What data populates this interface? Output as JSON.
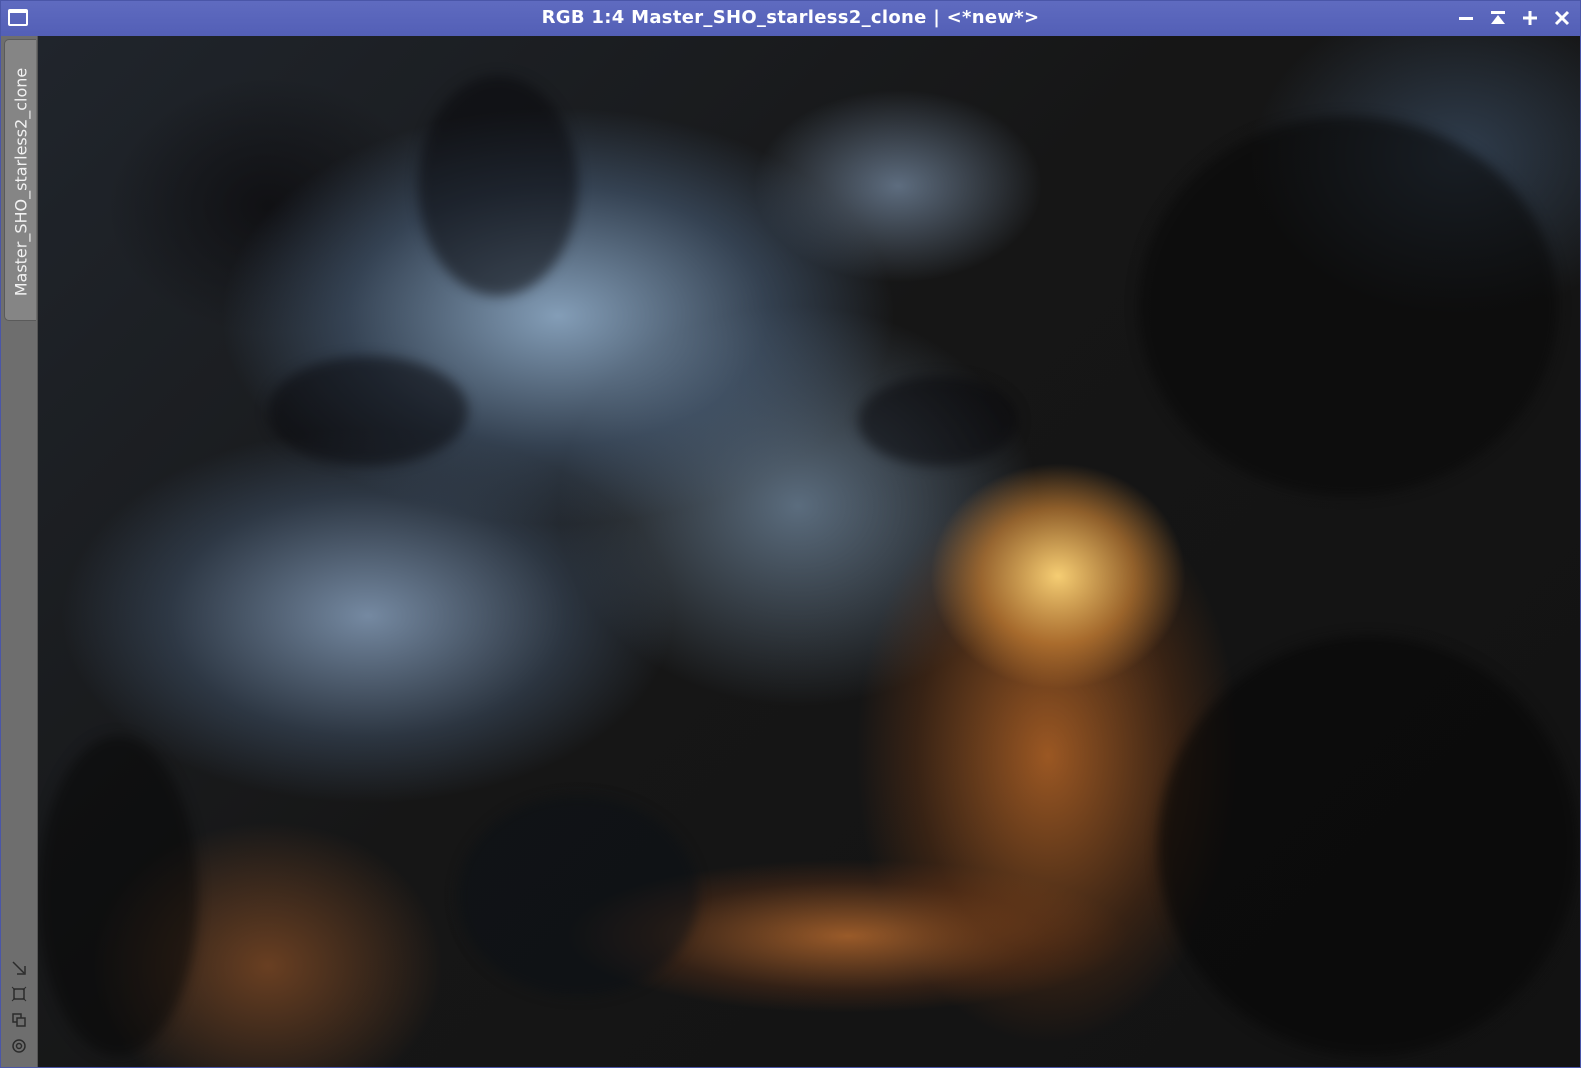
{
  "window": {
    "title": "RGB 1:4 Master_SHO_starless2_clone | <*new*>",
    "controls": [
      "minimize-icon",
      "shade-icon",
      "maximize-icon",
      "close-icon"
    ]
  },
  "sidebar": {
    "view_tab_label": "Master_SHO_starless2_clone",
    "tools": [
      "resize-arrow-icon",
      "fit-frame-icon",
      "clone-view-icon",
      "target-icon"
    ]
  },
  "image": {
    "description": ""
  },
  "colors": {
    "titlebar": "#5b67bb",
    "sidebar": "#6e6e6e",
    "view_tab": "#858585"
  }
}
